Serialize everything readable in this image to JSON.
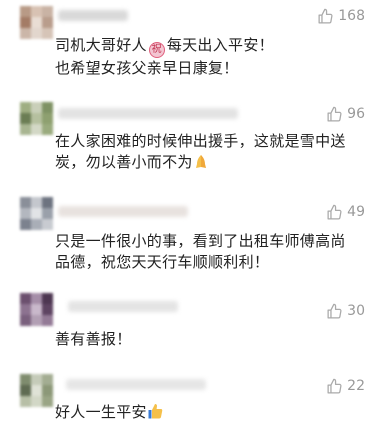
{
  "comments": [
    {
      "text_before_emoji": "司机大哥好人",
      "text_after_emoji": "每天出入平安！",
      "text_line2": "也希望女孩父亲早日康复！",
      "emoji": "blessing-emoji",
      "likes": "168"
    },
    {
      "text": "在人家困难的时候伸出援手，这就是雪中送炭，勿以善小而不为",
      "emoji": "praying-hands-emoji",
      "likes": "96"
    },
    {
      "text": "只是一件很小的事，看到了出租车师傅高尚品德，祝您天天行车顺顺利利！",
      "likes": "49"
    },
    {
      "text": "善有善报！",
      "likes": "30"
    },
    {
      "text": "好人一生平安",
      "emoji": "thumbs-up-emoji",
      "likes": "22"
    }
  ],
  "icons": {
    "like": "thumbs-up-outline-icon"
  },
  "colors": {
    "text": "#222222",
    "likes": "#999999",
    "icon": "#aaaaaa",
    "blessing": "#e0607e"
  }
}
